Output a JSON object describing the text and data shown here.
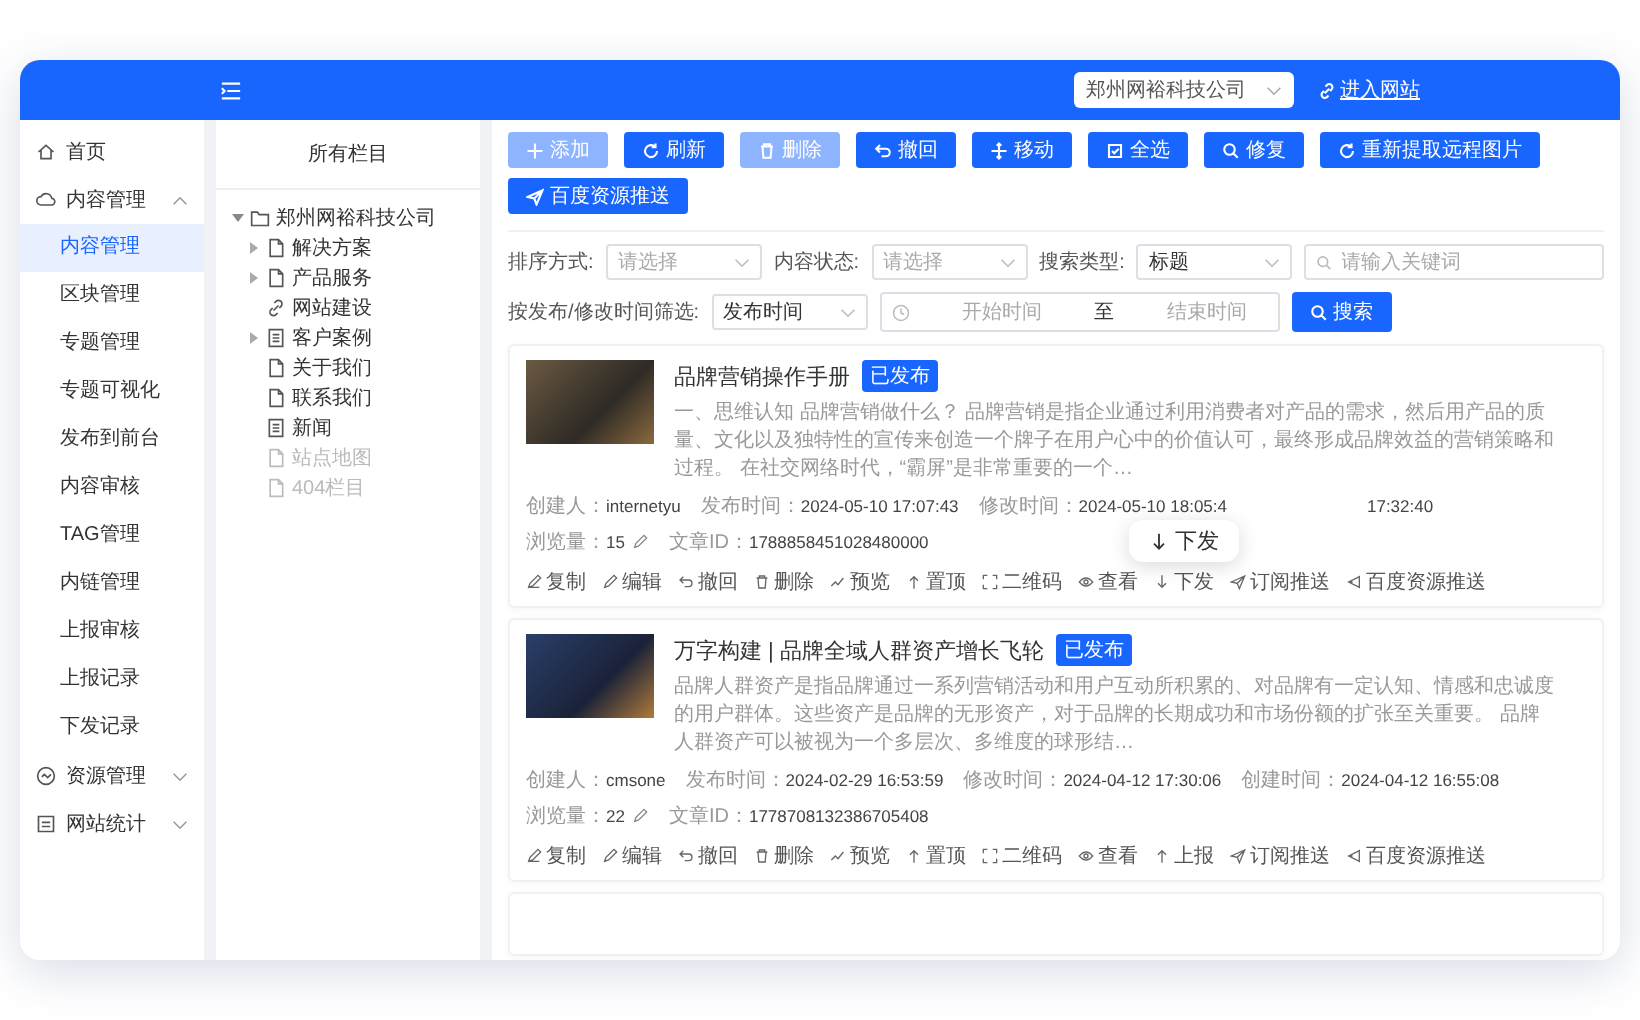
{
  "header": {
    "site_select": "郑州网裕科技公司",
    "enter_site_link": "进入网站"
  },
  "sidebar": {
    "items": [
      {
        "kind": "home",
        "label": "首页"
      },
      {
        "kind": "content",
        "label": "内容管理",
        "expanded": true,
        "children": [
          {
            "label": "内容管理",
            "selected": true
          },
          {
            "label": "区块管理",
            "selected": false
          },
          {
            "label": "专题管理",
            "selected": false
          },
          {
            "label": "专题可视化",
            "selected": false
          },
          {
            "label": "发布到前台",
            "selected": false
          },
          {
            "label": "内容审核",
            "selected": false
          },
          {
            "label": "TAG管理",
            "selected": false
          },
          {
            "label": "内链管理",
            "selected": false
          },
          {
            "label": "上报审核",
            "selected": false
          },
          {
            "label": "上报记录",
            "selected": false
          },
          {
            "label": "下发记录",
            "selected": false
          }
        ]
      },
      {
        "kind": "resource",
        "label": "资源管理",
        "expanded": false
      },
      {
        "kind": "stats",
        "label": "网站统计",
        "expanded": false
      }
    ]
  },
  "tree": {
    "title": "所有栏目",
    "root": {
      "label": "郑州网裕科技公司",
      "expanded": true,
      "children": [
        {
          "kind": "doc",
          "label": "解决方案",
          "expanded": false,
          "disabled": false
        },
        {
          "kind": "doc",
          "label": "产品服务",
          "expanded": false,
          "disabled": false
        },
        {
          "kind": "link",
          "label": "网站建设",
          "disabled": false
        },
        {
          "kind": "list",
          "label": "客户案例",
          "expanded": false,
          "disabled": false
        },
        {
          "kind": "doc",
          "label": "关于我们",
          "disabled": false
        },
        {
          "kind": "doc",
          "label": "联系我们",
          "disabled": false
        },
        {
          "kind": "list",
          "label": "新闻",
          "disabled": false
        },
        {
          "kind": "doc",
          "label": "站点地图",
          "disabled": true
        },
        {
          "kind": "doc",
          "label": "404栏目",
          "disabled": true
        }
      ]
    }
  },
  "toolbar": [
    {
      "kind": "plus",
      "label": "添加",
      "disabled": true
    },
    {
      "kind": "refresh",
      "label": "刷新",
      "disabled": false
    },
    {
      "kind": "trash",
      "label": "删除",
      "disabled": true
    },
    {
      "kind": "undo",
      "label": "撤回",
      "disabled": false
    },
    {
      "kind": "move",
      "label": "移动",
      "disabled": false
    },
    {
      "kind": "check",
      "label": "全选",
      "disabled": false
    },
    {
      "kind": "search",
      "label": "修复",
      "disabled": false
    },
    {
      "kind": "refresh",
      "label": "重新提取远程图片",
      "disabled": false
    },
    {
      "kind": "send",
      "label": "百度资源推送",
      "disabled": false
    }
  ],
  "filters": {
    "sort": {
      "label": "排序方式:",
      "placeholder": "请选择"
    },
    "status": {
      "label": "内容状态:",
      "placeholder": "请选择"
    },
    "search_type": {
      "label": "搜索类型:",
      "value": "标题"
    },
    "keyword": {
      "placeholder": "请输入关键词"
    },
    "time_filter": {
      "label": "按发布/修改时间筛选:",
      "value": "发布时间"
    },
    "range": {
      "start_placeholder": "开始时间",
      "separator": "至",
      "end_placeholder": "结束时间"
    },
    "search_button": "搜索"
  },
  "articles": [
    {
      "title": "品牌营销操作手册",
      "status": "已发布",
      "description": "一、思维认知 品牌营销做什么？ 品牌营销是指企业通过利用消费者对产品的需求，然后用产品的质量、文化以及独特性的宣传来创造一个牌子在用户心中的价值认可，最终形成品牌效益的营销策略和过程。 在社交网络时代，“霸屏”是非常重要的一个…",
      "meta": [
        {
          "label": "创建人：",
          "value": "internetyu"
        },
        {
          "label": "发布时间：",
          "value": "2024-05-10 17:07:43"
        },
        {
          "label": "修改时间：",
          "value": "2024-05-10 18:05:4"
        },
        {
          "value": "17:32:40"
        }
      ],
      "views_label": "浏览量：",
      "views": "15",
      "id_label": "文章ID：",
      "id": "1788858451028480000",
      "actions": [
        {
          "kind": "copy",
          "label": "复制"
        },
        {
          "kind": "edit",
          "label": "编辑"
        },
        {
          "kind": "undo",
          "label": "撤回"
        },
        {
          "kind": "trash",
          "label": "删除"
        },
        {
          "kind": "preview",
          "label": "预览"
        },
        {
          "kind": "up",
          "label": "置顶"
        },
        {
          "kind": "qr",
          "label": "二维码"
        },
        {
          "kind": "eye",
          "label": "查看"
        },
        {
          "kind": "down",
          "label": "下发",
          "tooltip": "下发"
        },
        {
          "kind": "send",
          "label": "订阅推送"
        },
        {
          "kind": "push",
          "label": "百度资源推送"
        }
      ]
    },
    {
      "title": "万字构建 | 品牌全域人群资产增长飞轮",
      "status": "已发布",
      "description": "品牌人群资产是指品牌通过一系列营销活动和用户互动所积累的、对品牌有一定认知、情感和忠诚度的用户群体。这些资产是品牌的无形资产，对于品牌的长期成功和市场份额的扩张至关重要。 品牌人群资产可以被视为一个多层次、多维度的球形结…",
      "meta": [
        {
          "label": "创建人：",
          "value": "cmsone"
        },
        {
          "label": "发布时间：",
          "value": "2024-02-29 16:53:59"
        },
        {
          "label": "修改时间：",
          "value": "2024-04-12 17:30:06"
        },
        {
          "label": "创建时间：",
          "value": "2024-04-12 16:55:08"
        }
      ],
      "views_label": "浏览量：",
      "views": "22",
      "id_label": "文章ID：",
      "id": "1778708132386705408",
      "actions": [
        {
          "kind": "copy",
          "label": "复制"
        },
        {
          "kind": "edit",
          "label": "编辑"
        },
        {
          "kind": "undo",
          "label": "撤回"
        },
        {
          "kind": "trash",
          "label": "删除"
        },
        {
          "kind": "preview",
          "label": "预览"
        },
        {
          "kind": "up",
          "label": "置顶"
        },
        {
          "kind": "qr",
          "label": "二维码"
        },
        {
          "kind": "eye",
          "label": "查看"
        },
        {
          "kind": "up",
          "label": "上报"
        },
        {
          "kind": "send",
          "label": "订阅推送"
        },
        {
          "kind": "push",
          "label": "百度资源推送"
        }
      ]
    }
  ]
}
